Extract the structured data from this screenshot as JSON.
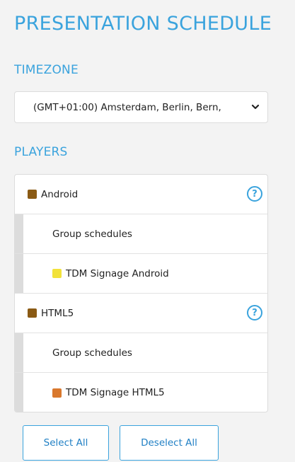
{
  "header": {
    "title": "PRESENTATION SCHEDULE"
  },
  "timezone": {
    "label": "TIMEZONE",
    "selected": "(GMT+01:00) Amsterdam, Berlin, Bern,",
    "icon": "chevron-down-icon"
  },
  "players": {
    "label": "PLAYERS",
    "groups": [
      {
        "name": "Android",
        "color": "#8a5a14",
        "help_icon": "question-circle-icon",
        "help_symbol": "?",
        "items": [
          {
            "label": "Group schedules"
          },
          {
            "label": "TDM Signage Android",
            "color": "#f2e23a"
          }
        ]
      },
      {
        "name": "HTML5",
        "color": "#8a5a14",
        "help_icon": "question-circle-icon",
        "help_symbol": "?",
        "items": [
          {
            "label": "Group schedules"
          },
          {
            "label": "TDM Signage HTML5",
            "color": "#d9782d"
          }
        ]
      }
    ]
  },
  "actions": {
    "select_all": "Select All",
    "deselect_all": "Deselect All"
  }
}
